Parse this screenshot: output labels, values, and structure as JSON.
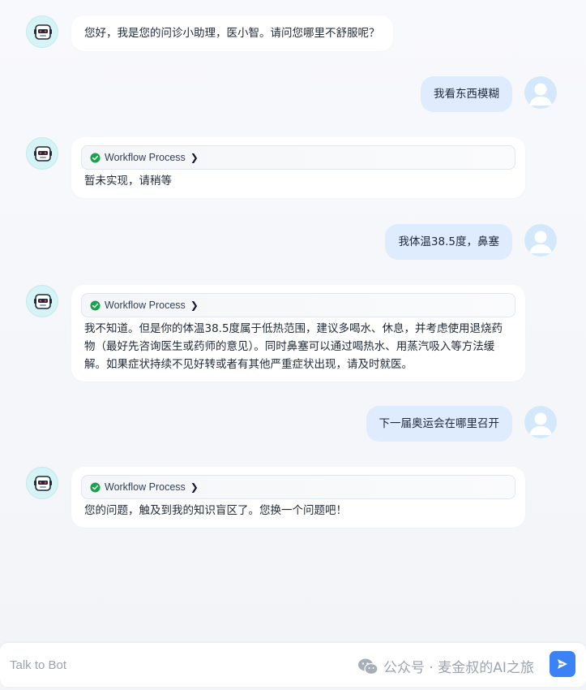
{
  "messages": [
    {
      "role": "bot",
      "text": "您好，我是您的问诊小助理，医小智。请问您哪里不舒服呢？"
    },
    {
      "role": "user",
      "text": "我看东西模糊"
    },
    {
      "role": "bot",
      "workflow": "Workflow Process",
      "text": "暂未实现，请稍等"
    },
    {
      "role": "user",
      "text": "我体温38.5度，鼻塞"
    },
    {
      "role": "bot",
      "workflow": "Workflow Process",
      "text": "我不知道。但是你的体温38.5度属于低热范围，建议多喝水、休息，并考虑使用退烧药物（最好先咨询医生或药师的意见）。同时鼻塞可以通过喝热水、用蒸汽吸入等方法缓解。如果症状持续不见好转或者有其他严重症状出现，请及时就医。"
    },
    {
      "role": "user",
      "text": "下一届奥运会在哪里召开"
    },
    {
      "role": "bot",
      "workflow": "Workflow Process",
      "text": "您的问题，触及到我的知识盲区了。您换一个问题吧！"
    }
  ],
  "input": {
    "placeholder": "Talk to Bot",
    "value": ""
  },
  "watermark": "公众号 · 麦金叔的AI之旅",
  "icons": {
    "bot_avatar": "robot-icon",
    "user_avatar": "user-silhouette-icon",
    "workflow_status": "check-circle-icon",
    "workflow_expand": "chevron-right-icon",
    "send": "send-icon",
    "watermark": "wechat-icon"
  },
  "colors": {
    "accent": "#3b82f6",
    "user_bubble": "#deecfd",
    "bot_bubble": "#ffffff",
    "success": "#16a34a",
    "bot_avatar_bg": "#d6f3f5",
    "user_avatar_bg": "#d3e8fb"
  }
}
